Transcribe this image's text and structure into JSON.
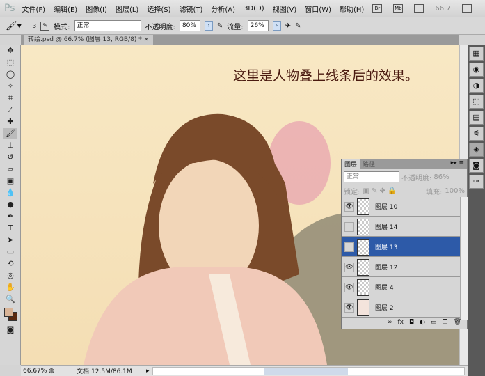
{
  "app": {
    "logo": "Ps"
  },
  "menu": [
    "文件(F)",
    "编辑(E)",
    "图像(I)",
    "图层(L)",
    "选择(S)",
    "滤镜(T)",
    "分析(A)",
    "3D(D)",
    "视图(V)",
    "窗口(W)",
    "帮助(H)"
  ],
  "appbar": {
    "bridge": "Br",
    "minibridge": "Mb",
    "zoom": "66.7"
  },
  "options": {
    "brush_size": "3",
    "mode_label": "模式:",
    "mode_value": "正常",
    "opacity_label": "不透明度:",
    "opacity_value": "80%",
    "flow_label": "流量:",
    "flow_value": "26%"
  },
  "document": {
    "tab_title": "转绘.psd @ 66.7% (图层 13, RGB/8) *",
    "close": "×"
  },
  "canvas": {
    "caption": "这里是人物叠上线条后的效果。"
  },
  "layers_panel": {
    "tabs": [
      "图层",
      "路径"
    ],
    "blend_mode": "正常",
    "opacity_label": "不透明度:",
    "opacity_value": "86%",
    "lock_label": "锁定:",
    "fill_label": "填充:",
    "fill_value": "100%",
    "layers": [
      {
        "name": "图层 10",
        "visible": true,
        "selected": false
      },
      {
        "name": "图层 14",
        "visible": false,
        "selected": false
      },
      {
        "name": "图层 13",
        "visible": false,
        "selected": true
      },
      {
        "name": "图层 12",
        "visible": true,
        "selected": false
      },
      {
        "name": "图层 4",
        "visible": true,
        "selected": false
      },
      {
        "name": "图层 2",
        "visible": true,
        "selected": false
      }
    ],
    "footer_icons": [
      "link-icon",
      "fx-icon",
      "mask-icon",
      "adjustment-icon",
      "group-icon",
      "new-layer-icon",
      "trash-icon"
    ]
  },
  "status": {
    "zoom": "66.67%",
    "doc_info": "文档:12.5M/86.1M"
  },
  "colors": {
    "foreground": "#d9b497",
    "background": "#5a2a10",
    "selection": "#2d5aa8"
  }
}
